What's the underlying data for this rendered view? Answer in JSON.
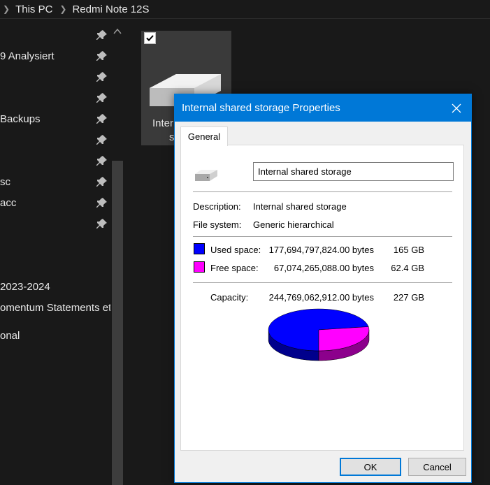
{
  "breadcrumb": {
    "items": [
      "This PC",
      "Redmi Note 12S"
    ]
  },
  "nav": {
    "items": [
      {
        "label": "9 Analysiert",
        "pinned": true
      },
      {
        "label": "",
        "pinned": true
      },
      {
        "label": "",
        "pinned": true
      },
      {
        "label": "Backups",
        "pinned": true
      },
      {
        "label": "",
        "pinned": true
      },
      {
        "label": "",
        "pinned": true
      },
      {
        "label": "sc",
        "pinned": true
      },
      {
        "label": "acc",
        "pinned": true
      },
      {
        "label": "",
        "pinned": true
      },
      {
        "label": "2023-2024",
        "pinned": false
      },
      {
        "label": "omentum Statements etc",
        "pinned": false
      },
      {
        "label": "onal",
        "pinned": false
      }
    ]
  },
  "tile": {
    "label_line1": "Inter",
    "label_line2": "s",
    "checked": true
  },
  "dialog": {
    "title": "Internal shared storage Properties",
    "tab": "General",
    "name_value": "Internal shared storage",
    "description_label": "Description:",
    "description_value": "Internal shared storage",
    "filesystem_label": "File system:",
    "filesystem_value": "Generic hierarchical",
    "used": {
      "label": "Used space:",
      "bytes": "177,694,797,824.00 bytes",
      "size": "165 GB",
      "color": "#0000ff"
    },
    "free": {
      "label": "Free space:",
      "bytes": "67,074,265,088.00 bytes",
      "size": "62.4 GB",
      "color": "#ff00ff"
    },
    "capacity": {
      "label": "Capacity:",
      "bytes": "244,769,062,912.00 bytes",
      "size": "227 GB"
    },
    "ok_label": "OK",
    "cancel_label": "Cancel"
  },
  "chart_data": {
    "type": "pie",
    "categories": [
      "Used space",
      "Free space"
    ],
    "values": [
      177694797824,
      67074265088
    ],
    "colors": [
      "#0000ff",
      "#ff00ff"
    ]
  }
}
